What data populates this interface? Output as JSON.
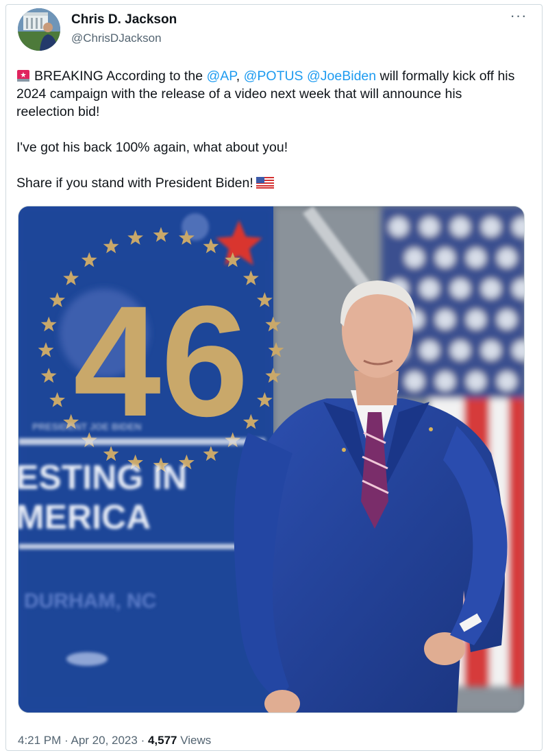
{
  "author": {
    "name": "Chris D. Jackson",
    "handle": "@ChrisDJackson"
  },
  "tweet": {
    "line1_prefix": "BREAKING According to the ",
    "mention_ap": "@AP",
    "comma": ",",
    "mention_potus": "@POTUS",
    "mention_biden": "@JoeBiden",
    "line1_rest": " will formally kick off his 2024 campaign with the release of a video next week that will announce his reelection bid!",
    "paragraph2": "I've got his back 100% again, what about you!",
    "paragraph3": "Share if you stand with President Biden!"
  },
  "media": {
    "badge_number": "46",
    "sign_line1": "ESTING IN",
    "sign_line2": "MERICA",
    "sign_line3": "DURHAM, NC",
    "sign_top": "PRESIDENT JOE BIDEN"
  },
  "footer": {
    "time": "4:21 PM",
    "separator1": " · ",
    "date": "Apr 20, 2023",
    "separator2": " · ",
    "views_count": "4,577",
    "views_label": " Views"
  },
  "icons": {
    "more": "more-icon",
    "siren": "siren-icon",
    "flag": "us-flag-icon"
  },
  "colors": {
    "link": "#1d9bf0",
    "secondary_text": "#536471",
    "primary_text": "#0f1419",
    "sign_blue": "#1f4aa0",
    "gold": "#c9a86a"
  }
}
